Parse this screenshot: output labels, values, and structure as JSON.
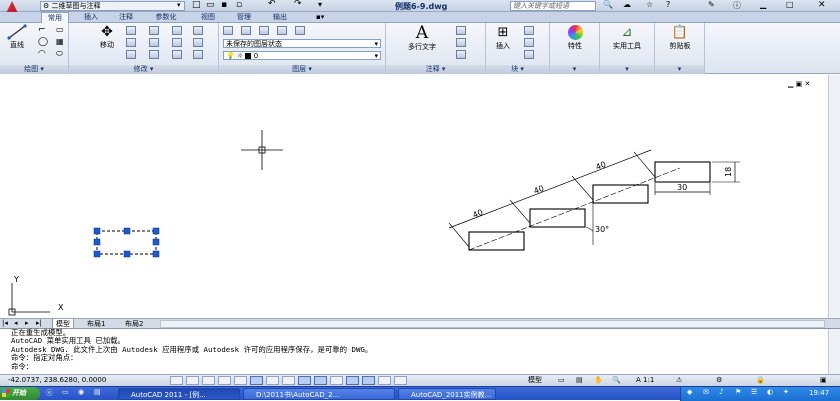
{
  "title": {
    "workspace": "二维草图与注释",
    "document": "例题6-9.dwg",
    "search_placeholder": "键入关键字或短语"
  },
  "menu_tabs": [
    "常用",
    "插入",
    "注释",
    "参数化",
    "视图",
    "管理",
    "输出"
  ],
  "ribbon": {
    "draw": {
      "label": "绘图",
      "line": "直线"
    },
    "modify": {
      "label": "修改",
      "move": "移动"
    },
    "layers": {
      "label": "图层",
      "layer_state": "未保存的图层状态",
      "current_layer": "0"
    },
    "annotation": {
      "label": "注释",
      "multiline_text": "多行文字"
    },
    "block": {
      "label": "块",
      "insert": "插入"
    },
    "properties": {
      "label": "特性"
    },
    "utilities": {
      "label": "实用工具"
    },
    "clipboard": {
      "label": "剪贴板"
    }
  },
  "drawing": {
    "dimensions": [
      "40",
      "40",
      "40",
      "30",
      "18",
      "30°"
    ],
    "ucs_x": "X",
    "ucs_y": "Y"
  },
  "layout_tabs": [
    "模型",
    "布局1",
    "布局2"
  ],
  "command_lines": [
    "正在重生成模型。",
    "AutoCAD 菜单实用工具 已加载。",
    "Autodesk DWG.   此文件上次由 Autodesk 应用程序或 Autodesk 许可的应用程序保存，是可靠的 DWG。",
    "命令：指定对角点：",
    "命令："
  ],
  "status": {
    "coordinates": "-42.0737, 238.6280, 0.0000",
    "space": "模型",
    "annotation_scale": "A 1:1"
  },
  "taskbar": {
    "start": "开始",
    "tasks": [
      "AutoCAD 2011 - [例...",
      "D:\\2011书\\AutoCAD_2...",
      "AutoCAD_2011实例教..."
    ],
    "clock": "19:47"
  },
  "colors": {
    "accent": "#c8102e",
    "ribbon_bg": "#dde5f0",
    "taskbar": "#2452c8",
    "grip": "#1a5cd8"
  }
}
